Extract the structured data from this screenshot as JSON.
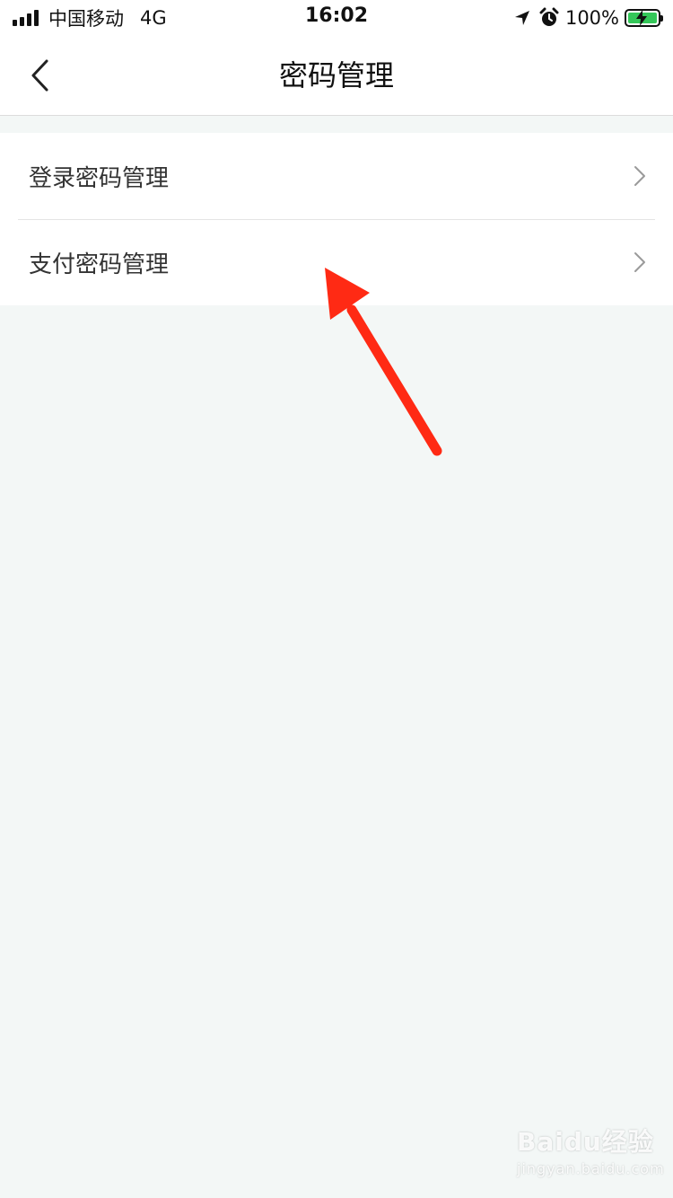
{
  "status_bar": {
    "carrier": "中国移动",
    "network": "4G",
    "time": "16:02",
    "battery": "100%"
  },
  "nav": {
    "title": "密码管理"
  },
  "menu": {
    "items": [
      {
        "label": "登录密码管理"
      },
      {
        "label": "支付密码管理"
      }
    ]
  },
  "watermark": {
    "logo": "Baidu经验",
    "url": "jingyan.baidu.com"
  },
  "colors": {
    "background": "#f3f7f6",
    "annotation_arrow": "#ff2a14",
    "battery_fill": "#34c759"
  }
}
